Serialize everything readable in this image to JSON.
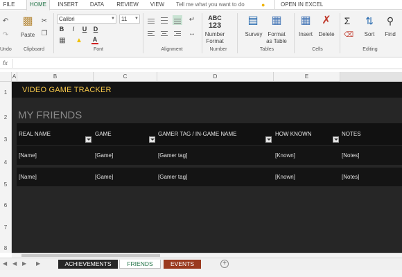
{
  "ribbon_tabs": [
    "FILE",
    "HOME",
    "INSERT",
    "DATA",
    "REVIEW",
    "VIEW"
  ],
  "active_tab": "HOME",
  "tell_me": {
    "placeholder": "Tell me what you want to do"
  },
  "open_in_excel": "OPEN IN EXCEL",
  "clipboard": {
    "undo_label": "Undo",
    "paste_label": "Paste",
    "group_label": "Clipboard"
  },
  "font": {
    "name": "Calibri",
    "size": "11",
    "bold": "B",
    "italic": "I",
    "underline": "U",
    "strike": "D",
    "font_color": "A",
    "group_label": "Font"
  },
  "alignment": {
    "group_label": "Alignment"
  },
  "number": {
    "abc": "ABC",
    "num": "123",
    "label_line1": "Number",
    "label_line2": "Format",
    "group_label": "Number"
  },
  "tables": {
    "survey_label": "Survey",
    "format_line1": "Format",
    "format_line2": "as Table",
    "group_label": "Tables"
  },
  "cells": {
    "insert_label": "Insert",
    "delete_label": "Delete",
    "group_label": "Cells"
  },
  "editing": {
    "sort_label": "Sort",
    "find_label": "Find",
    "sum_symbol": "Σ",
    "group_label": "Editing"
  },
  "formula_bar": {
    "fx": "fx"
  },
  "columns": [
    "A",
    "B",
    "C",
    "D",
    "E"
  ],
  "rows": [
    "1",
    "2",
    "3",
    "4",
    "5",
    "6",
    "7",
    "8"
  ],
  "sheet": {
    "title": "VIDEO GAME TRACKER",
    "section_title": "MY FRIENDS",
    "headers": [
      "REAL NAME",
      "GAME",
      "GAMER TAG / IN-GAME NAME",
      "HOW KNOWN",
      "NOTES"
    ],
    "data_rows": [
      [
        "[Name]",
        "[Game]",
        "[Gamer tag]",
        "[Known]",
        "[Notes]"
      ],
      [
        "[Name]",
        "[Game]",
        "[Gamer tag]",
        "[Known]",
        "[Notes]"
      ]
    ]
  },
  "sheet_tabs": [
    {
      "label": "ACHIEVEMENTS",
      "bg": "#262626",
      "fg": "#ffffff"
    },
    {
      "label": "FRIENDS",
      "bg": "#ffffff",
      "fg": "#217346"
    },
    {
      "label": "EVENTS",
      "bg": "#9a3a1f",
      "fg": "#ffffff"
    }
  ],
  "colors": {
    "title": "#f6c84a",
    "accent": "#217346",
    "sheet_bg": "#262626"
  }
}
